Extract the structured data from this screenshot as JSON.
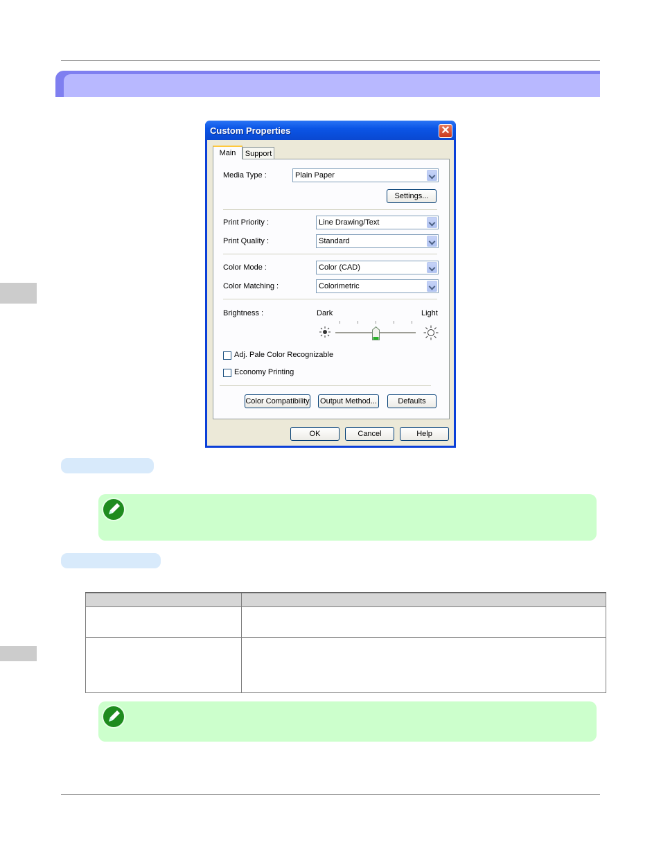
{
  "dialog": {
    "title": "Custom Properties",
    "close_glyph": "✕",
    "tabs": [
      {
        "label": "Main"
      },
      {
        "label": "Support"
      }
    ],
    "media_type": {
      "label": "Media Type :",
      "value": "Plain Paper",
      "button": "Settings..."
    },
    "print_priority": {
      "label": "Print Priority :",
      "value": "Line Drawing/Text"
    },
    "print_quality": {
      "label": "Print Quality :",
      "value": "Standard"
    },
    "color_mode": {
      "label": "Color Mode :",
      "value": "Color (CAD)"
    },
    "color_matching": {
      "label": "Color Matching :",
      "value": "Colorimetric"
    },
    "brightness": {
      "label": "Brightness :",
      "dark_label": "Dark",
      "light_label": "Light",
      "level_fraction": 0.5,
      "tick_count": 5
    },
    "checkboxes": [
      {
        "label": "Adj. Pale Color Recognizable",
        "checked": false
      },
      {
        "label": "Economy Printing",
        "checked": false
      }
    ],
    "panel_buttons": {
      "color_compat": "Color Compatibility",
      "output_method": "Output Method...",
      "defaults": "Defaults"
    },
    "footer_buttons": {
      "ok": "OK",
      "cancel": "Cancel",
      "help": "Help"
    }
  },
  "colors": {
    "title_band": "#b8b8ff",
    "note_bg": "#ccffcc",
    "section_pill": "#d8eafb",
    "xp_title_blue": "#0b55e6"
  },
  "icons": [
    "pencil-note-icon",
    "sun-dark-icon",
    "sun-light-icon",
    "close-icon",
    "dropdown-arrow-icon"
  ]
}
